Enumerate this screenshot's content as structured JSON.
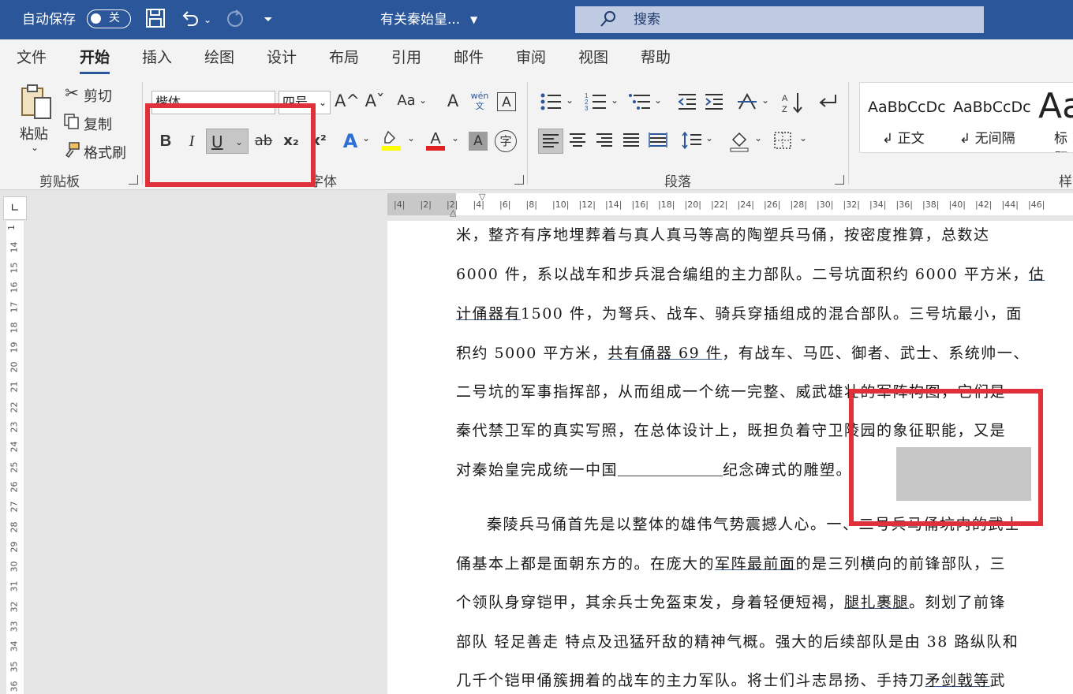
{
  "titlebar": {
    "autosave_label": "自动保存",
    "autosave_state": "关",
    "doc_title": "有关秦始皇...",
    "search_placeholder": "搜索",
    "icons": [
      "save-icon",
      "undo-icon",
      "redo-icon",
      "customize-icon",
      "search-icon"
    ]
  },
  "menu": {
    "tabs": [
      "文件",
      "开始",
      "插入",
      "绘图",
      "设计",
      "布局",
      "引用",
      "邮件",
      "审阅",
      "视图",
      "帮助"
    ],
    "active": "开始"
  },
  "ribbon": {
    "clipboard": {
      "paste": "粘贴",
      "cut": "剪切",
      "copy": "复制",
      "format_painter": "格式刷",
      "group_label": "剪贴板"
    },
    "font": {
      "font_name": "楷体",
      "font_size": "四号",
      "grow": "A^",
      "shrink": "Aˇ",
      "case": "Aa",
      "phonetic": "wén 文",
      "char_border": "A",
      "bold": "B",
      "italic": "I",
      "underline": "U",
      "strike": "ab",
      "subscript": "x₂",
      "superscript": "x²",
      "effect": "A",
      "highlight_color": "#ffff00",
      "font_color": "#e02020",
      "shading": "A",
      "enclose": "字",
      "group_label": "字体"
    },
    "paragraph": {
      "group_label": "段落"
    },
    "styles": {
      "items": [
        {
          "preview": "AaBbCcDc",
          "name": "正文"
        },
        {
          "preview": "AaBbCcDc",
          "name": "无间隔"
        },
        {
          "preview": "Aa",
          "name": "标题"
        }
      ],
      "group_label": "样"
    }
  },
  "ruler": {
    "h_ticks": [
      "4",
      "2",
      "2",
      "4",
      "6",
      "8",
      "10",
      "12",
      "14",
      "16",
      "18",
      "20",
      "22",
      "24",
      "26",
      "28",
      "30",
      "32",
      "34",
      "36",
      "38",
      "40",
      "42",
      "44",
      "46"
    ],
    "v_ticks": [
      "1",
      "14",
      "15",
      "16",
      "17",
      "18",
      "19",
      "20",
      "21",
      "22",
      "23",
      "24",
      "25",
      "26",
      "27",
      "28",
      "29",
      "30",
      "31",
      "32",
      "33",
      "34",
      "35",
      "36"
    ]
  },
  "document": {
    "l1": "米，整齐有序地埋葬着与真人真马等高的陶塑兵马俑，按密度推算，总数达",
    "l2a": "6000 件，系以战车和步兵混合编组的主力部队。二号坑面积约 6000 平方米，",
    "l2b": "估",
    "l3a": "计俑器有",
    "l3b": "1500 件，为弩兵、战车、骑兵穿插组成的混合部队。三号坑最小，面",
    "l4a": "积约 5000 平方米，",
    "l4b": "共有俑器 69 件",
    "l4c": "，有战车、马匹、御者、武士、系统帅一、",
    "l5": "二号坑的军事指挥部，从而组成一个统一完整、威武雄壮的军阵构图，它们是",
    "l6": "秦代禁卫军的真实写照，在总体设计上，既担负着守卫陵园的象征职能，又是",
    "l7a": "对秦始皇完成统一中国",
    "l7b": "纪念碑式的雕塑。",
    "l8": "秦陵兵马俑首先是以整体的雄伟气势震撼人心。一、二号兵马俑坑内的武士",
    "l9a": "俑基本上都是面朝东方的。在庞大的",
    "l9b": "军阵最前面",
    "l9c": "的是三列横向的前锋部队，三",
    "l10a": "个领队身穿铠甲，其余兵士免盔束发，身着轻便短褐，",
    "l10b": "腿扎裹腿",
    "l10c": "。刻划了前锋",
    "l11": "部队 轻足善走 特点及迅猛歼敌的精神气概。强大的后续部队是由 38 路纵队和",
    "l12a": "几千个铠甲俑簇拥着的战车的主力军队。将士们斗志昂扬、手持刀",
    "l12b": "矛剑戟等",
    "l12c": "武"
  },
  "annotations": {
    "highlight_color": "#e0303a"
  }
}
